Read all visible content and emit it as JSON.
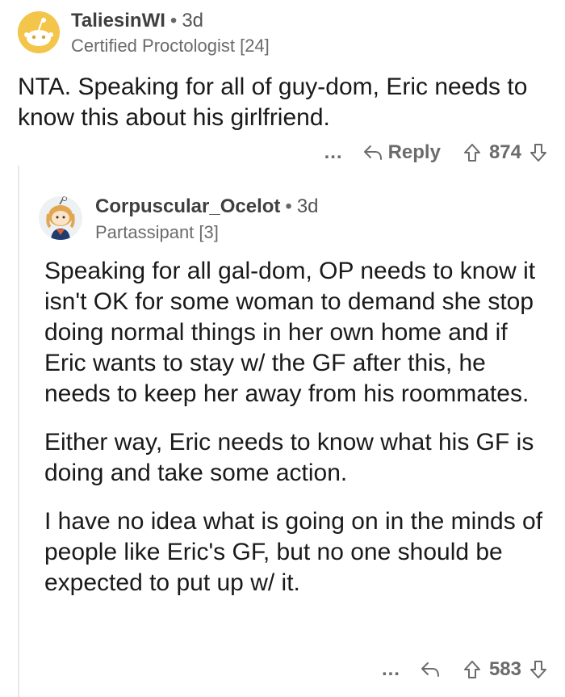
{
  "comments": [
    {
      "username": "TaliesinWI",
      "separator": "•",
      "age": "3d",
      "flair": "Certified Proctologist [24]",
      "paragraphs": [
        "NTA.  Speaking for all of guy-dom, Eric needs to know this about his girlfriend."
      ],
      "more": "...",
      "reply_label": "Reply",
      "score": "874"
    },
    {
      "username": "Corpuscular_Ocelot",
      "separator": "•",
      "age": "3d",
      "flair": "Partassipant [3]",
      "paragraphs": [
        "Speaking for all gal-dom, OP needs to know it isn't OK for some woman to demand she stop doing normal things in her own home and if Eric wants to stay w/ the GF after this, he needs to keep her away from his roommates.",
        "Either way, Eric needs to know what his GF is doing  and take some action.",
        "I have no idea what is going on in the minds of people like Eric's GF, but no one should be expected to put up w/ it."
      ],
      "more": "...",
      "score": "583"
    }
  ],
  "colors": {
    "avatar_bg_1": "#f3c64b",
    "avatar_bg_2": "#eef1f4",
    "meta_gray": "#6b6b6b"
  }
}
